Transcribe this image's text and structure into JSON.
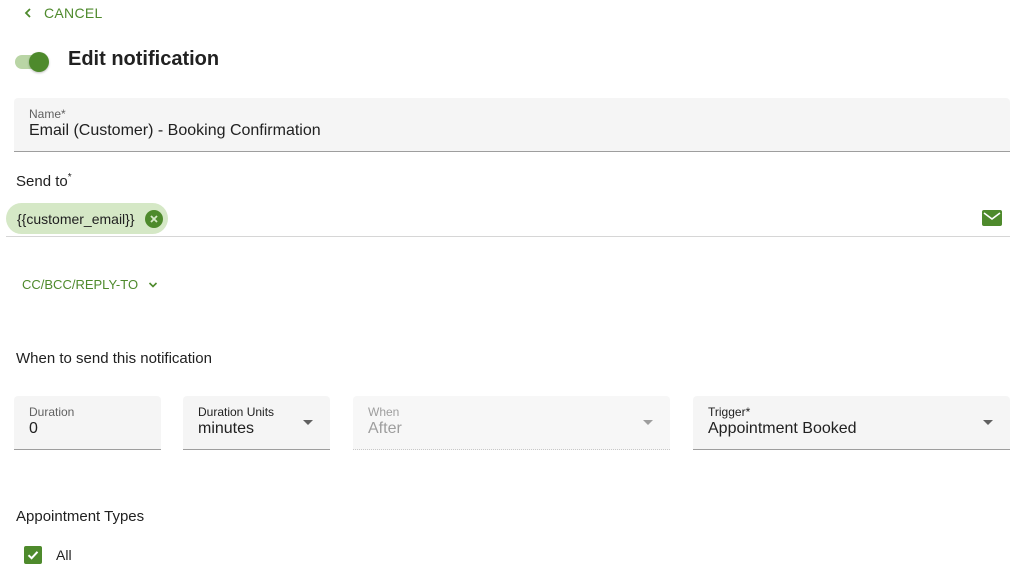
{
  "header": {
    "cancel_label": "CANCEL",
    "title": "Edit notification",
    "enabled": true
  },
  "name_field": {
    "label": "Name*",
    "value": "Email (Customer) - Booking Confirmation"
  },
  "send_to": {
    "label": "Send to",
    "required_marker": "*",
    "chips": [
      "{{customer_email}}"
    ],
    "icon": "mail-icon"
  },
  "cc_bcc": {
    "label": "CC/BCC/REPLY-TO"
  },
  "timing": {
    "section_label": "When to send this notification",
    "duration": {
      "label": "Duration",
      "value": "0"
    },
    "duration_units": {
      "label": "Duration Units",
      "value": "minutes"
    },
    "when": {
      "label": "When",
      "value": "After",
      "disabled": true
    },
    "trigger": {
      "label": "Trigger*",
      "value": "Appointment Booked"
    }
  },
  "appointment_types": {
    "section_label": "Appointment Types",
    "options": [
      {
        "label": "All",
        "checked": true
      }
    ]
  },
  "colors": {
    "accent": "#4e8a2c",
    "chip_bg": "#d5e8c6",
    "field_bg": "#f5f5f5"
  }
}
